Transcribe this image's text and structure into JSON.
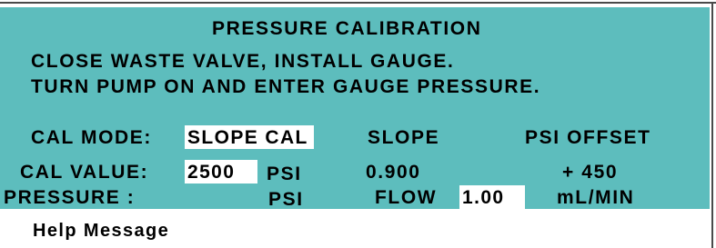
{
  "title": "PRESSURE CALIBRATION",
  "instructions": [
    "CLOSE WASTE VALVE,  INSTALL GAUGE.",
    "TURN PUMP ON AND ENTER GAUGE PRESSURE."
  ],
  "cal_mode": {
    "label": "CAL MODE:",
    "value": "SLOPE CAL"
  },
  "slope": {
    "header": "SLOPE",
    "value": "0.900"
  },
  "psi_offset": {
    "header": "PSI OFFSET",
    "value": "+ 450"
  },
  "cal_value": {
    "label": "CAL VALUE:",
    "value": "2500",
    "unit": "PSI"
  },
  "pressure": {
    "label": "PRESSURE :",
    "unit": "PSI"
  },
  "flow": {
    "label": "FLOW",
    "value": "1.00",
    "unit": "mL/MIN"
  },
  "help": {
    "label": "Help Message"
  },
  "colors": {
    "panel_background": "#5dbdbd",
    "field_background": "#ffffff",
    "text": "#000000"
  }
}
